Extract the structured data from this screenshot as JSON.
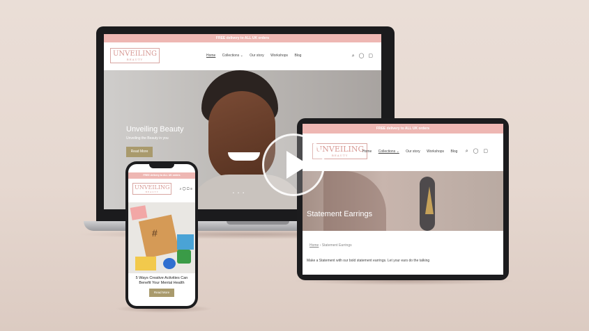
{
  "brand": {
    "logo_text": "UNVEILING",
    "logo_sub": "BEAUTY"
  },
  "announcement": "FREE delivery to ALL UK orders",
  "nav": {
    "items": [
      "Home",
      "Collections ⌄",
      "Our story",
      "Workshops",
      "Blog"
    ]
  },
  "laptop": {
    "hero_title": "Unveiling Beauty",
    "hero_subtitle": "Unveiling the Beauty in you",
    "button": "Read More"
  },
  "tablet": {
    "hero_title": "Statement Earrings",
    "breadcrumb_home": "Home",
    "breadcrumb_current": "Statement Earrings",
    "description": "Make a Statement with our bold statement earrings. Let your ears do the talking"
  },
  "phone": {
    "article_title": "5 Ways Creative Activities Can Benefit Your Mental Health",
    "button": "Read More"
  },
  "icons": [
    "search-icon",
    "account-icon",
    "cart-icon",
    "menu-icon",
    "play-icon"
  ]
}
